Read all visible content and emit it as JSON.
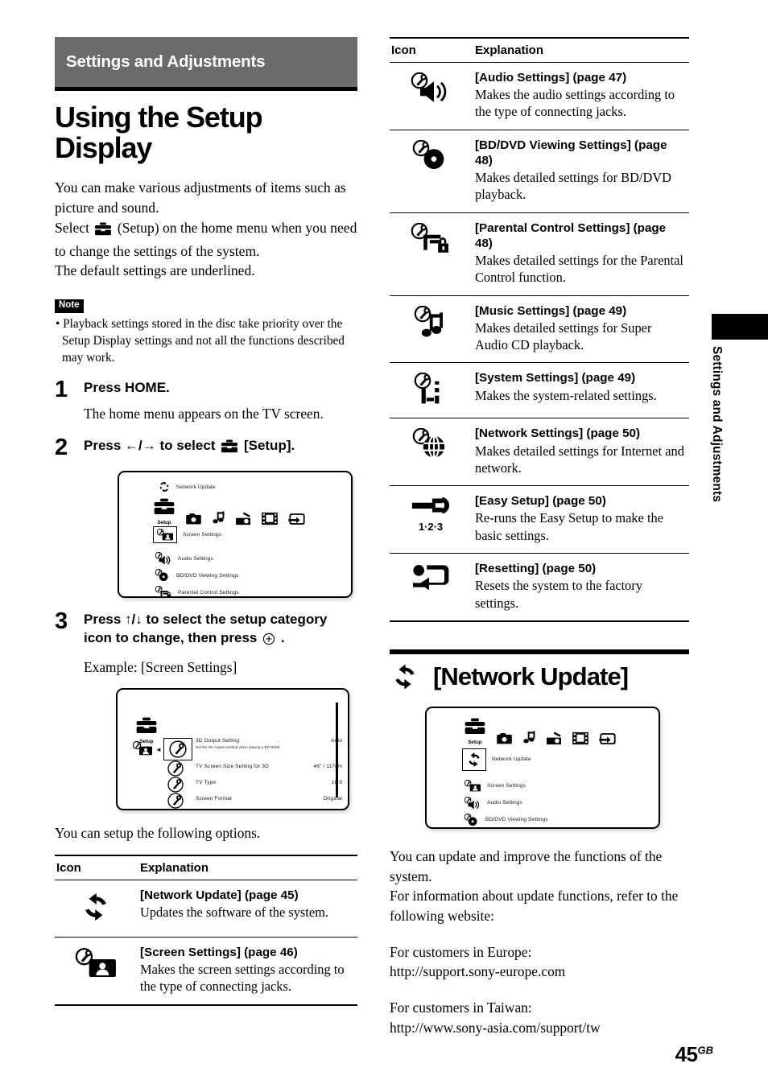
{
  "chapter": {
    "bar_title": "Settings and Adjustments",
    "side_tab": "Settings and Adjustments"
  },
  "page_title": "Using the Setup Display",
  "intro": {
    "line1": "You can make various adjustments of items such as picture and sound.",
    "line2_pre": "Select",
    "line2_post": "(Setup) on the home menu when you need to change the settings of the system.",
    "line3": "The default settings are underlined."
  },
  "note": {
    "tag": "Note",
    "text": "• Playback settings stored in the disc take priority over the Setup Display settings and not all the functions described may work."
  },
  "steps": [
    {
      "number": "1",
      "heading": "Press HOME.",
      "sub": "The home menu appears on the TV screen."
    },
    {
      "number": "2",
      "heading_pre": "Press ←/→ to select",
      "heading_post": "[Setup]."
    },
    {
      "number": "3",
      "heading_pre": "Press ↑/↓ to select the setup category icon to change, then press",
      "heading_post": ".",
      "sub": "Example: [Screen Settings]"
    }
  ],
  "tv_home_menu": {
    "top_item": "Network Update",
    "setup_caption": "Setup",
    "media_icons": [
      "setup-toolbox-icon",
      "photo-camera-icon",
      "music-note-icon",
      "radio-icon",
      "film-strip-icon",
      "input-icon"
    ],
    "items": [
      {
        "label": "Screen Settings",
        "selected": true
      },
      {
        "label": "Audio Settings",
        "selected": false
      },
      {
        "label": "BD/DVD Viewing Settings",
        "selected": false
      },
      {
        "label": "Parental Control Settings",
        "selected": false
      }
    ]
  },
  "tv_screen_settings": {
    "setup_caption": "Setup",
    "rows": [
      {
        "label": "3D Output Setting",
        "value": "Auto",
        "desc": "Set the 3D output method when playing a BD-ROM.",
        "selected": true
      },
      {
        "label": "TV Screen Size Setting for 3D",
        "value": "46\" / 117cm",
        "desc": "",
        "selected": false
      },
      {
        "label": "TV Type",
        "value": "16:9",
        "desc": "",
        "selected": false
      },
      {
        "label": "Screen Format",
        "value": "Original",
        "desc": "",
        "selected": false
      }
    ]
  },
  "options_intro": "You can setup the following options.",
  "table_left": {
    "header_icon": "Icon",
    "header_explanation": "Explanation",
    "rows": [
      {
        "icon": "network-update-icon",
        "title": "[Network Update] (page 45)",
        "desc": "Updates the software of the system."
      },
      {
        "icon": "screen-settings-icon",
        "title": "[Screen Settings] (page 46)",
        "desc": "Makes the screen settings according to the type of connecting jacks."
      }
    ]
  },
  "table_right": {
    "header_icon": "Icon",
    "header_explanation": "Explanation",
    "rows": [
      {
        "icon": "audio-settings-icon",
        "title": "[Audio Settings] (page 47)",
        "desc": "Makes the audio settings according to the type of connecting jacks."
      },
      {
        "icon": "bd-dvd-viewing-settings-icon",
        "title": "[BD/DVD Viewing Settings] (page 48)",
        "desc": "Makes detailed settings for BD/DVD playback."
      },
      {
        "icon": "parental-control-settings-icon",
        "title": "[Parental Control Settings] (page 48)",
        "desc": "Makes detailed settings for the Parental Control function."
      },
      {
        "icon": "music-settings-icon",
        "title": "[Music Settings] (page 49)",
        "desc": "Makes detailed settings for Super Audio CD playback."
      },
      {
        "icon": "system-settings-icon",
        "title": "[System Settings] (page 49)",
        "desc": "Makes the system-related settings."
      },
      {
        "icon": "network-settings-icon",
        "title": "[Network Settings] (page 50)",
        "desc": "Makes detailed settings for Internet and network."
      },
      {
        "icon": "easy-setup-icon",
        "icon_caption": "1·2·3",
        "title": "[Easy Setup] (page 50)",
        "desc": "Re-runs the Easy Setup to make the basic settings."
      },
      {
        "icon": "resetting-icon",
        "title": "[Resetting] (page 50)",
        "desc": "Resets the system to the factory settings."
      }
    ]
  },
  "network_update_section": {
    "title": "[Network Update]",
    "icon": "network-update-icon",
    "tv": {
      "setup_caption": "Setup",
      "selected_item": "Network Update",
      "items": [
        {
          "label": "Screen Settings"
        },
        {
          "label": "Audio Settings"
        },
        {
          "label": "BD/DVD Viewing Settings"
        }
      ]
    },
    "para1": "You can update and improve the functions of the system.",
    "para2": "For information about update functions, refer to the following website:",
    "europe_label": "For customers in Europe:",
    "europe_url": "http://support.sony-europe.com",
    "taiwan_label": "For customers in Taiwan:",
    "taiwan_url": "http://www.sony-asia.com/support/tw"
  },
  "footer": {
    "page_number": "45",
    "region": "GB"
  },
  "colors": {
    "chapter_bar": "#6b6b6b",
    "rule": "#000000",
    "text": "#000000",
    "page_bg": "#ffffff"
  }
}
